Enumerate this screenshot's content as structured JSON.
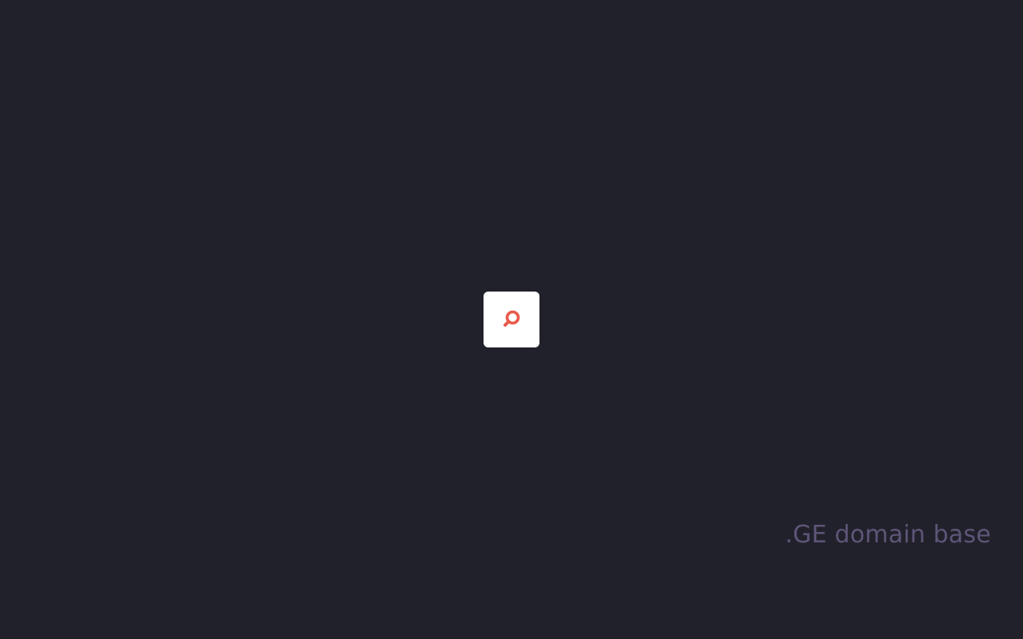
{
  "theme": {
    "background": "#21212b",
    "tile_background": "#ffffff",
    "icon_color": "#e9594a",
    "caption_color": "#5e5578"
  },
  "search_tile": {
    "icon": "search-icon"
  },
  "footer": {
    "caption": ".GE domain base"
  }
}
